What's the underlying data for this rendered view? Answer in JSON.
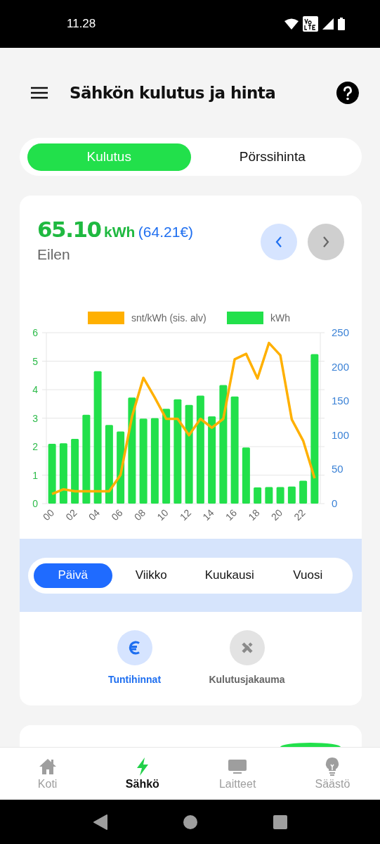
{
  "status_bar": {
    "time": "11.28"
  },
  "header": {
    "title": "Sähkön kulutus ja hinta"
  },
  "mode_tabs": [
    {
      "label": "Kulutus",
      "selected": true
    },
    {
      "label": "Pörssihinta",
      "selected": false
    }
  ],
  "summary": {
    "amount": "65.10",
    "unit": "kWh",
    "cost": "(64.21€)",
    "period": "Eilen",
    "next_disabled": true
  },
  "chart_data": {
    "type": "bar",
    "grid": true,
    "legend": "top",
    "xlim": [
      -0.5,
      23.5
    ],
    "x": [
      0,
      1,
      2,
      3,
      4,
      5,
      6,
      7,
      8,
      9,
      10,
      11,
      12,
      13,
      14,
      15,
      16,
      17,
      18,
      19,
      20,
      21,
      22,
      23
    ],
    "xticks": [
      {
        "value": 0,
        "label": "00"
      },
      {
        "value": 2,
        "label": "02"
      },
      {
        "value": 4,
        "label": "04"
      },
      {
        "value": 6,
        "label": "06"
      },
      {
        "value": 8,
        "label": "08"
      },
      {
        "value": 10,
        "label": "10"
      },
      {
        "value": 12,
        "label": "12"
      },
      {
        "value": 14,
        "label": "14"
      },
      {
        "value": 16,
        "label": "16"
      },
      {
        "value": 18,
        "label": "18"
      },
      {
        "value": 20,
        "label": "20"
      },
      {
        "value": 22,
        "label": "22"
      }
    ],
    "ylim": [
      0,
      6
    ],
    "yticks": [
      0,
      1,
      2,
      3,
      4,
      5,
      6
    ],
    "y2lim": [
      0,
      250
    ],
    "y2ticks": [
      0,
      50,
      100,
      150,
      200,
      250
    ],
    "series": [
      {
        "name": "snt/kWh (sis. alv)",
        "color": "#ffb000",
        "type": "line",
        "axis": "y2",
        "values": [
          14,
          21,
          18,
          18,
          18,
          18,
          42,
          127,
          184,
          155,
          124,
          124,
          100,
          124,
          111,
          124,
          211,
          219,
          183,
          235,
          217,
          123,
          92,
          37
        ]
      },
      {
        "name": "kWh",
        "color": "#22e04b",
        "type": "bar",
        "values": [
          2.1,
          2.12,
          2.27,
          3.12,
          4.65,
          2.76,
          2.53,
          3.72,
          2.98,
          3.0,
          3.33,
          3.66,
          3.46,
          3.79,
          3.06,
          4.16,
          3.76,
          1.97,
          0.57,
          0.58,
          0.58,
          0.6,
          0.8,
          5.25
        ]
      }
    ]
  },
  "period_tabs": [
    {
      "label": "Päivä",
      "selected": true
    },
    {
      "label": "Viikko",
      "selected": false
    },
    {
      "label": "Kuukausi",
      "selected": false
    },
    {
      "label": "Vuosi",
      "selected": false
    }
  ],
  "views": [
    {
      "label": "Tuntihinnat",
      "selected": true,
      "kind": "euro"
    },
    {
      "label": "Kulutusjakauma",
      "selected": false,
      "kind": "cross"
    }
  ],
  "bottom_nav": [
    {
      "label": "Koti",
      "selected": false,
      "kind": "home"
    },
    {
      "label": "Sähkö",
      "selected": true,
      "kind": "bolt"
    },
    {
      "label": "Laitteet",
      "selected": false,
      "kind": "screen"
    },
    {
      "label": "Säästö",
      "selected": false,
      "kind": "bulb"
    }
  ]
}
